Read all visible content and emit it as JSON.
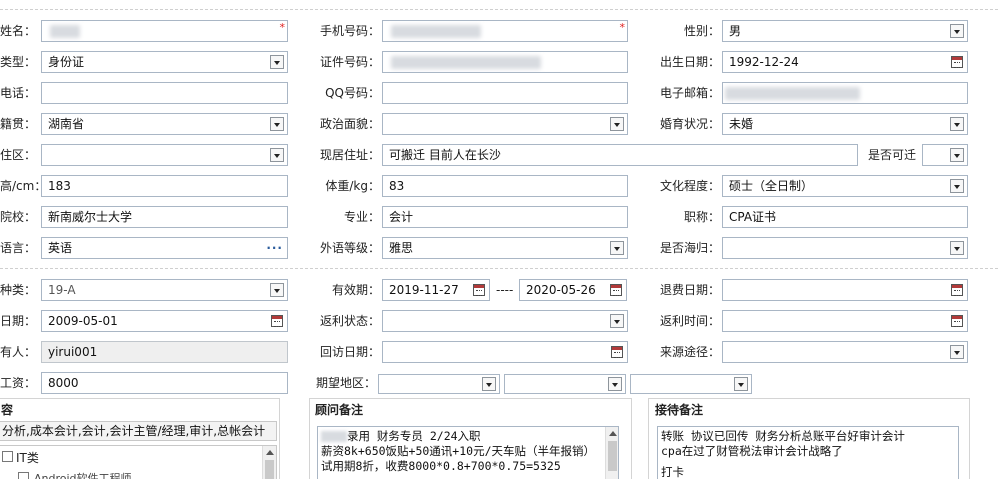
{
  "personal": {
    "name_label": "姓名：",
    "mobile_label": "手机号码：",
    "gender_label": "性别：",
    "gender_value": "男",
    "id_type_label": "类型：",
    "id_type_value": "身份证",
    "id_number_label": "证件号码：",
    "birth_label": "出生日期：",
    "birth_value": "1992-12-24",
    "phone_label": "电话：",
    "qq_label": "QQ号码：",
    "email_label": "电子邮箱：",
    "native_label": "籍贯：",
    "native_value": "湖南省",
    "politics_label": "政治面貌：",
    "marital_label": "婚育状况：",
    "marital_value": "未婚",
    "residence_label": "住区：",
    "address_label": "现居住址：",
    "address_value": "可搬迁 目前人在长沙",
    "relocate_label": "是否可迁",
    "height_label": "高/cm：",
    "height_value": "183",
    "weight_label": "体重/kg：",
    "weight_value": "83",
    "education_label": "文化程度：",
    "education_value": "硕士（全日制）",
    "school_label": "院校：",
    "school_value": "新南威尔士大学",
    "major_label": "专业：",
    "major_value": "会计",
    "title_label": "职称：",
    "title_value": "CPA证书",
    "language_label": "语言：",
    "language_value": "英语",
    "language_level_label": "外语等级：",
    "language_level_value": "雅思",
    "overseas_label": "是否海归："
  },
  "service": {
    "kind_label": "种类：",
    "kind_value": "19-A",
    "validity_label": "有效期：",
    "validity_start": "2019-11-27",
    "validity_sep": "----",
    "validity_end": "2020-05-26",
    "refund_date_label": "退费日期：",
    "date_label": "日期：",
    "date_value": "2009-05-01",
    "rebate_status_label": "返利状态：",
    "rebate_time_label": "返利时间：",
    "owner_label": "有人：",
    "owner_value": "yirui001",
    "revisit_label": "回访日期：",
    "source_label": "来源途径：",
    "salary_label": "工资：",
    "salary_value": "8000",
    "region_label": "期望地区："
  },
  "content": {
    "title": "容",
    "jobs_value": "分析,成本会计,会计,会计主管/经理,审计,总帐会计",
    "tree_item_1": "IT类",
    "tree_item_2": "Android软件工程师"
  },
  "consultant": {
    "title": "顾问备注",
    "line1": "录用 财务专员  2/24入职",
    "line2": "薪资8k+650饭贴+50通讯+10元/天车贴（半年报销）",
    "line3": "试用期8折，收费8000*0.8+700*0.75=5325"
  },
  "reception": {
    "title": "接待备注",
    "line1": "转账 协议已回传 财务分析总账平台好审计会计",
    "line2": "cpa在过了财管税法审计会计战略了",
    "line3": "打卡"
  },
  "colors": {
    "required_star": "#e02020",
    "field_border": "#a9b6c5",
    "readonly_bg": "#efefef"
  },
  "icons": [
    "dropdown-arrow-icon",
    "calendar-icon",
    "more-dots-icon",
    "scroll-up-icon",
    "checkbox-icon"
  ]
}
